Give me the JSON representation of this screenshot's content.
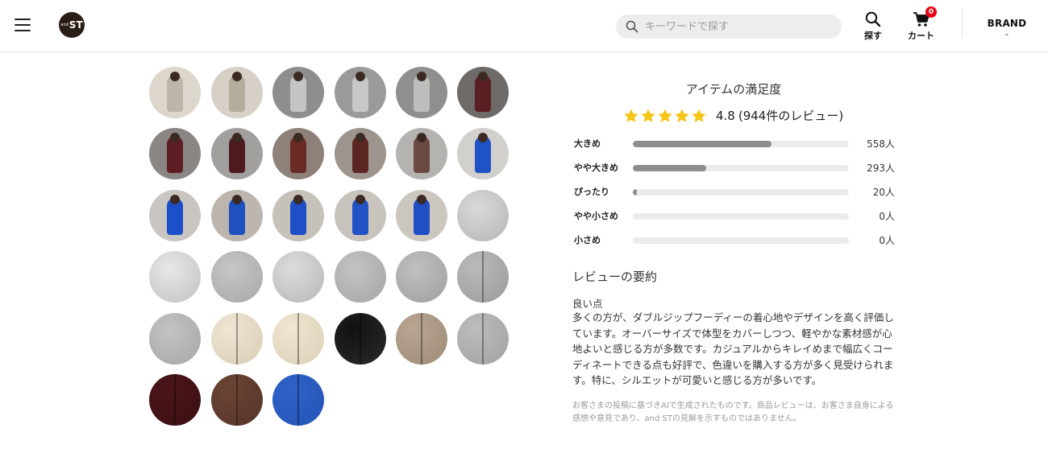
{
  "header": {
    "logo_text": "ST",
    "logo_small": "and",
    "search_placeholder": "キーワードで探す",
    "find_label": "探す",
    "cart_label": "カート",
    "cart_count": "0",
    "brand_label": "BRAND",
    "brand_chevron": "⌄"
  },
  "thumbnails": [
    {
      "bg": "#c7c3bd",
      "fg": "#8f8a82",
      "type": "person"
    },
    {
      "bg": "#4a4a4a",
      "fg": "#1d1d1f",
      "type": "person"
    },
    {
      "bg": "#b9b9b9",
      "fg": "#8d8d8d",
      "type": "person"
    },
    {
      "bg": "#c8c4bd",
      "fg": "#a49d94",
      "type": "person"
    },
    {
      "bg": "#bdb6ab",
      "fg": "#8c8376",
      "type": "person"
    },
    {
      "bg": "#c9c3ba",
      "fg": "#a8a196",
      "type": "person"
    },
    {
      "bg": "#dcd6cc",
      "fg": "#bdb5a7",
      "type": "person"
    },
    {
      "bg": "#d6d0c6",
      "fg": "#b4ac9d",
      "type": "person"
    },
    {
      "bg": "#8e8e8e",
      "fg": "#c4c4c4",
      "type": "person"
    },
    {
      "bg": "#9a9a9a",
      "fg": "#c7c7c7",
      "type": "person"
    },
    {
      "bg": "#8f8f8d",
      "fg": "#bdbdbd",
      "type": "person"
    },
    {
      "bg": "#6d6a68",
      "fg": "#5a1f22",
      "type": "person"
    },
    {
      "bg": "#8a8684",
      "fg": "#5e1d22",
      "type": "person"
    },
    {
      "bg": "#a2a09e",
      "fg": "#4f1a1e",
      "type": "person"
    },
    {
      "bg": "#8e817a",
      "fg": "#6a2b25",
      "type": "person"
    },
    {
      "bg": "#9d948d",
      "fg": "#5b2622",
      "type": "person"
    },
    {
      "bg": "#b5b3b0",
      "fg": "#6a4a42",
      "type": "person"
    },
    {
      "bg": "#d2d0cc",
      "fg": "#1f52c4",
      "type": "person"
    },
    {
      "bg": "#c9c6c2",
      "fg": "#1d4fc8",
      "type": "person"
    },
    {
      "bg": "#bcb6ae",
      "fg": "#1e50c2",
      "type": "person"
    },
    {
      "bg": "#c6c1b9",
      "fg": "#1f4fc6",
      "type": "person"
    },
    {
      "bg": "#c8c3bc",
      "fg": "#2251c4",
      "type": "person"
    },
    {
      "bg": "#cbc6be",
      "fg": "#1f4ec5",
      "type": "person"
    },
    {
      "bg": "#d9d9d9",
      "fg": "#b5b5b5",
      "type": "garment"
    },
    {
      "bg": "#e7e7e7",
      "fg": "#c2c2c2",
      "type": "garment"
    },
    {
      "bg": "#c6c6c6",
      "fg": "#a8a8a8",
      "type": "garment"
    },
    {
      "bg": "#dcdcdc",
      "fg": "#b7b7b7",
      "type": "garment"
    },
    {
      "bg": "#c4c4c4",
      "fg": "#a4a4a4",
      "type": "garment"
    },
    {
      "bg": "#c0c0c0",
      "fg": "#9e9e9e",
      "type": "garment"
    },
    {
      "bg": "#bababa",
      "fg": "#9b9b9b",
      "type": "zip"
    },
    {
      "bg": "#c3c3c3",
      "fg": "#a6a6a6",
      "type": "garment"
    },
    {
      "bg": "#eee5d3",
      "fg": "#d9cdb6",
      "type": "zip"
    },
    {
      "bg": "#efe5d2",
      "fg": "#dbcfb6",
      "type": "zip"
    },
    {
      "bg": "#121212",
      "fg": "#2a2a2a",
      "type": "zip"
    },
    {
      "bg": "#b7a692",
      "fg": "#9d8b76",
      "type": "zip"
    },
    {
      "bg": "#bcbcbc",
      "fg": "#a2a2a2",
      "type": "zip"
    },
    {
      "bg": "#4b1519",
      "fg": "#3a0f12",
      "type": "zip"
    },
    {
      "bg": "#6b4433",
      "fg": "#55342a",
      "type": "zip"
    },
    {
      "bg": "#2f63c9",
      "fg": "#2453b5",
      "type": "zip"
    }
  ],
  "satisfaction": {
    "title": "アイテムの満足度",
    "rating": "4.8",
    "review_count": "(944件のレビュー)",
    "star_color": "#f5c518",
    "stars": 5
  },
  "fit": [
    {
      "label": "大きめ",
      "count": "558人",
      "ratio": 0.64
    },
    {
      "label": "やや大きめ",
      "count": "293人",
      "ratio": 0.34
    },
    {
      "label": "ぴったり",
      "count": "20人",
      "ratio": 0.02
    },
    {
      "label": "やや小さめ",
      "count": "0人",
      "ratio": 0
    },
    {
      "label": "小さめ",
      "count": "0人",
      "ratio": 0
    }
  ],
  "summary": {
    "title": "レビューの要約",
    "good_label": "良い点",
    "body": "多くの方が、ダブルジップフーディーの着心地やデザインを高く評価しています。オーバーサイズで体型をカバーしつつ、軽やかな素材感が心地よいと感じる方が多数です。カジュアルからキレイめまで幅広くコーディネートできる点も好評で、色違いを購入する方が多く見受けられます。特に、シルエットが可愛いと感じる方が多いです。",
    "disclaimer": "お客さまの投稿に基づきAIで生成されたものです。商品レビューは、お客さま自身による感想や意見であり、and STの見解を示すものではありません。"
  }
}
